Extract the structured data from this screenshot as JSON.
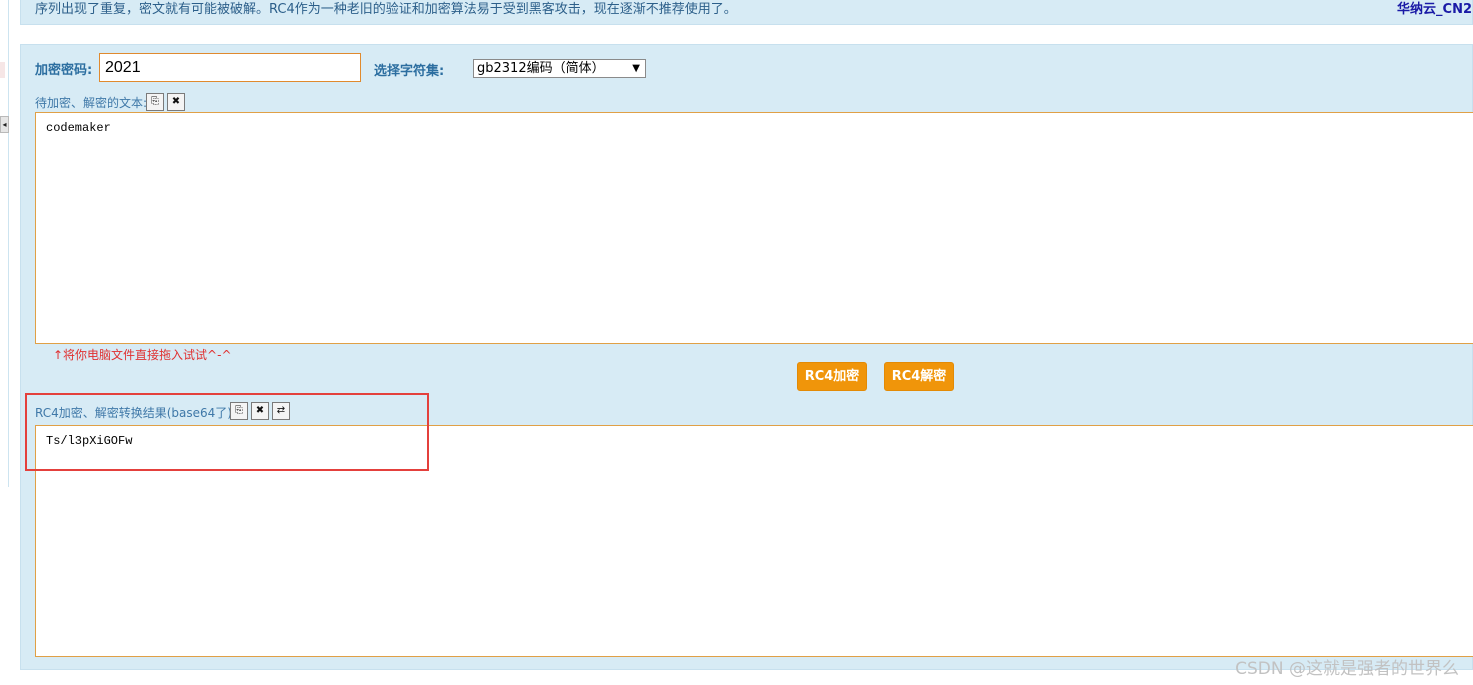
{
  "banner": {
    "notice": "序列出现了重复，密文就有可能被破解。RC4作为一种老旧的验证和加密算法易于受到黑客攻击，现在逐渐不推荐使用了。",
    "ad_link": "华纳云_CN2"
  },
  "form": {
    "key_label": "加密密码:",
    "key_value": "2021",
    "charset_label": "选择字符集:",
    "charset_selected": "gb2312编码（简体）",
    "input_label": "待加密、解密的文本:",
    "input_text": "codemaker",
    "drag_hint": "↑将你电脑文件直接拖入试试^-^",
    "encrypt_button": "RC4加密",
    "decrypt_button": "RC4解密",
    "result_label": "RC4加密、解密转换结果(base64了):",
    "result_text": "Ts/l3pXiGOFw"
  },
  "icons": {
    "copy": "⎘",
    "clear": "✖",
    "swap": "⇄",
    "dropdown": "▼",
    "collapse": "◂"
  },
  "watermark": "CSDN @这就是强者的世界么",
  "colors": {
    "panel_bg": "#d7ebf5",
    "button_orange": "#f0950a",
    "highlight_red": "#e4403c"
  }
}
